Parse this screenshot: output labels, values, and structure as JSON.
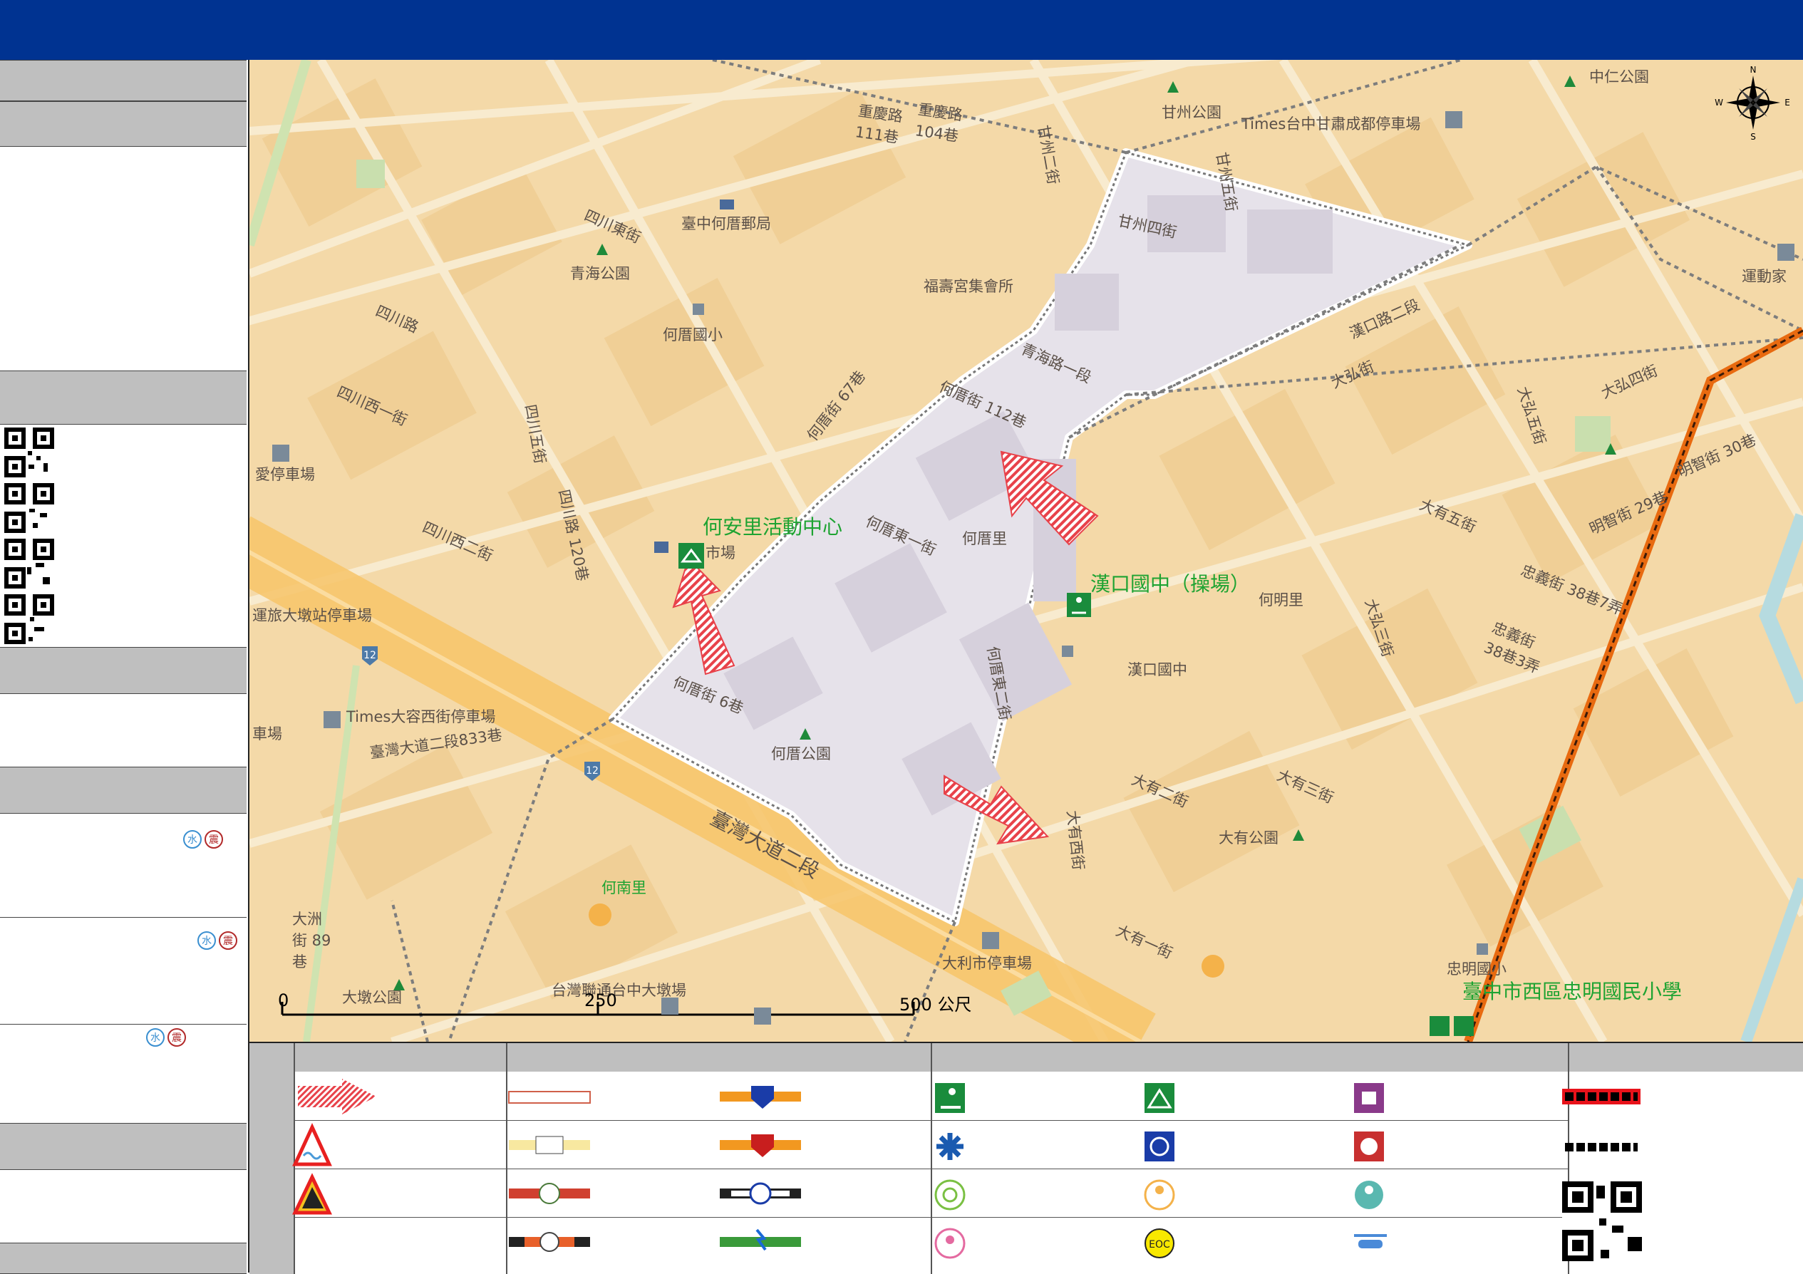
{
  "colors": {
    "header": "#003391",
    "sidebar_bar": "#bfbfbf",
    "map_base": "#f4d9a8",
    "evac_area": "#e6e2ea",
    "arrow_red": "#e8424a",
    "green_label": "#1ea332",
    "boundary_orange": "#e86a10"
  },
  "map": {
    "labels": [
      {
        "text": "甘州公園"
      },
      {
        "text": "Times台中甘肅成都停車場"
      },
      {
        "text": "中仁公園"
      },
      {
        "text": "重慶路 111巷"
      },
      {
        "text": "重慶路 104巷"
      },
      {
        "text": "甘州二街"
      },
      {
        "text": "甘州五街"
      },
      {
        "text": "甘州四街"
      },
      {
        "text": "福壽宮集會所"
      },
      {
        "text": "臺中何厝郵局"
      },
      {
        "text": "四川東街"
      },
      {
        "text": "青海公園"
      },
      {
        "text": "何厝國小"
      },
      {
        "text": "四川路"
      },
      {
        "text": "四川西一街"
      },
      {
        "text": "四川西二街"
      },
      {
        "text": "四川五街"
      },
      {
        "text": "四川路 120巷"
      },
      {
        "text": "青海路一段"
      },
      {
        "text": "漢口路二段"
      },
      {
        "text": "何厝街 112巷"
      },
      {
        "text": "何厝街 67巷"
      },
      {
        "text": "何厝東一街"
      },
      {
        "text": "何厝里"
      },
      {
        "text": "何厝東二街"
      },
      {
        "text": "何明里"
      },
      {
        "text": "漢口國中"
      },
      {
        "text": "何厝街 6巷"
      },
      {
        "text": "何厝公園"
      },
      {
        "text": "臺灣大道二段"
      },
      {
        "text": "臺灣大道二段833巷"
      },
      {
        "text": "Times大容西街停車場"
      },
      {
        "text": "台灣聯通台中大墩場"
      },
      {
        "text": "大利市停車場"
      },
      {
        "text": "大有公園"
      },
      {
        "text": "大有三街"
      },
      {
        "text": "大有二街"
      },
      {
        "text": "大有一街"
      },
      {
        "text": "大有西街"
      },
      {
        "text": "大弘街"
      },
      {
        "text": "大弘五街"
      },
      {
        "text": "大弘四街"
      },
      {
        "text": "大弘三街"
      },
      {
        "text": "大有五街"
      },
      {
        "text": "明智街 30巷"
      },
      {
        "text": "明智街 29巷"
      },
      {
        "text": "忠義街 38巷7弄"
      },
      {
        "text": "忠義街 38巷3弄"
      },
      {
        "text": "忠明國小"
      },
      {
        "text": "何南里"
      },
      {
        "text": "大墩公園"
      },
      {
        "text": "大洲街 89巷"
      },
      {
        "text": "運動家"
      },
      {
        "text": "市場"
      },
      {
        "text": "愛停車場"
      },
      {
        "text": "車場"
      },
      {
        "text": "運旅大墩站停車場"
      }
    ],
    "green_labels": {
      "activity_center": "何安里活動中心",
      "school_field": "漢口國中（操場）",
      "zhongming_school": "臺中市西區忠明國民小學"
    },
    "scale": {
      "t0": "0",
      "t250": "250",
      "t500": "500 公尺"
    },
    "compass": {
      "n": "N",
      "e": "E",
      "s": "S",
      "w": "W"
    },
    "highway_number": "12"
  },
  "sidebar": {
    "badges": [
      "水",
      "震"
    ]
  },
  "legend": {
    "qr_note": ""
  }
}
